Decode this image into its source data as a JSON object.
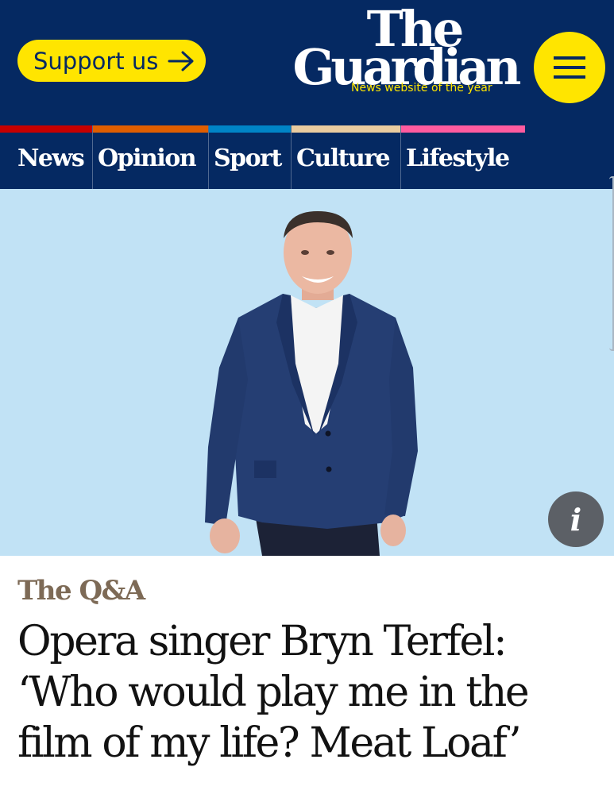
{
  "header": {
    "support_label": "Support us",
    "logo_line1": "The",
    "logo_line2": "Guardian",
    "tagline": "News website of the year",
    "menu_icon": "hamburger-menu-icon"
  },
  "nav": {
    "pillars": [
      {
        "label": "News",
        "color": "#c70000"
      },
      {
        "label": "Opinion",
        "color": "#e05e00"
      },
      {
        "label": "Sport",
        "color": "#0084c6"
      },
      {
        "label": "Culture",
        "color": "#eacca0"
      },
      {
        "label": "Lifestyle",
        "color": "#ff5b9f"
      }
    ]
  },
  "media": {
    "background_color": "#c1e2f5",
    "info_label": "i"
  },
  "article": {
    "kicker": "The Q&A",
    "headline": "Opera singer Bryn Terfel: ‘Who would play me in the film of my life? Meat Loaf’"
  },
  "colors": {
    "brand_blue": "#052962",
    "brand_yellow": "#ffe500",
    "kicker_brown": "#7d6a56"
  }
}
